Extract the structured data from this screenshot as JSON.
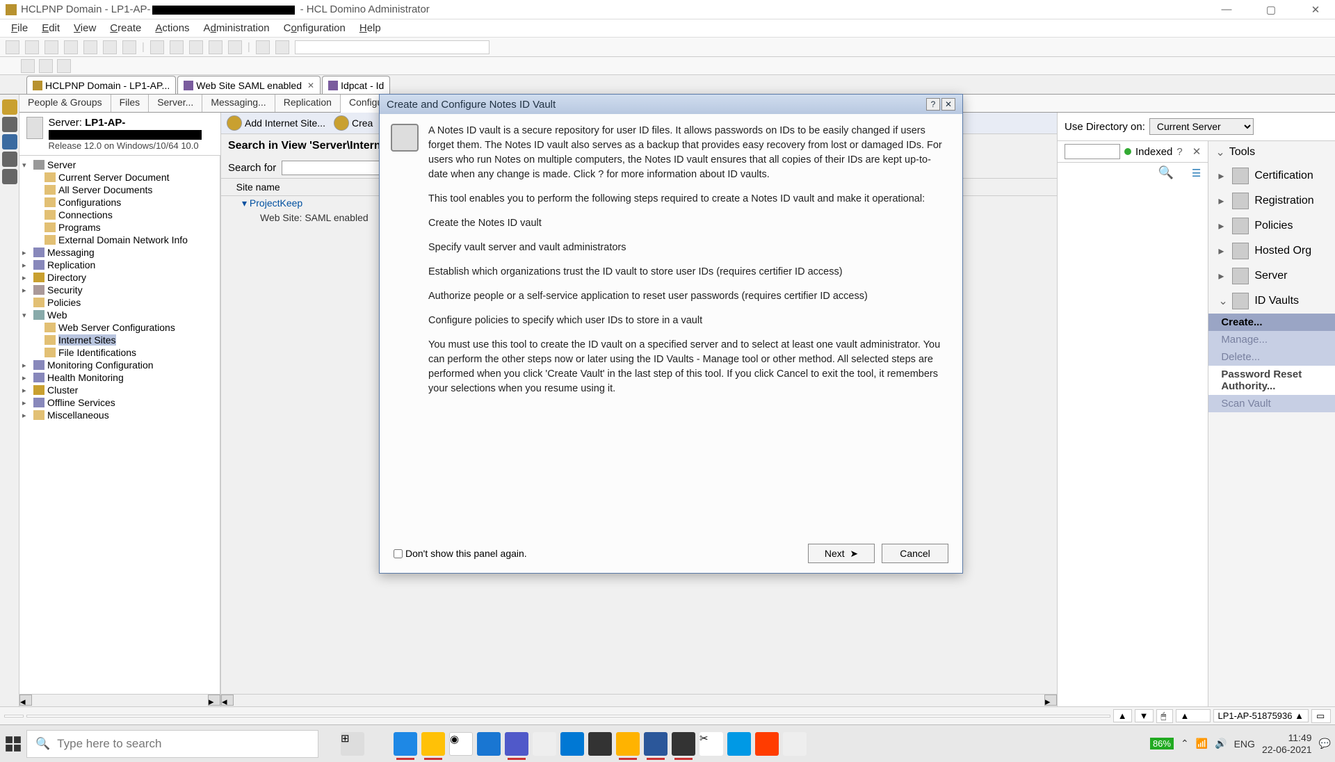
{
  "window": {
    "title_prefix": "HCLPNP Domain - LP1-AP-",
    "title_suffix": "- HCL Domino Administrator"
  },
  "menus": [
    "File",
    "Edit",
    "View",
    "Create",
    "Actions",
    "Administration",
    "Configuration",
    "Help"
  ],
  "tabs": [
    {
      "label": "HCLPNP Domain - LP1-AP..."
    },
    {
      "label": "Web Site SAML enabled"
    },
    {
      "label": "Idpcat - Id"
    }
  ],
  "subtabs": [
    "People & Groups",
    "Files",
    "Server...",
    "Messaging...",
    "Replication",
    "Configuration"
  ],
  "server": {
    "label": "Server:",
    "name_prefix": "LP1-AP-",
    "release": "Release 12.0 on Windows/10/64 10.0"
  },
  "tree": {
    "server": "Server",
    "csd": "Current Server Document",
    "asd": "All Server Documents",
    "conf": "Configurations",
    "conn": "Connections",
    "prog": "Programs",
    "edni": "External Domain Network Info",
    "msg": "Messaging",
    "repl": "Replication",
    "dir": "Directory",
    "sec": "Security",
    "pol": "Policies",
    "web": "Web",
    "wsc": "Web Server Configurations",
    "isites": "Internet Sites",
    "fid": "File Identifications",
    "monc": "Monitoring Configuration",
    "hm": "Health Monitoring",
    "cluster": "Cluster",
    "off": "Offline Services",
    "misc": "Miscellaneous"
  },
  "actions": {
    "add": "Add Internet Site...",
    "create": "Crea"
  },
  "search": {
    "header": "Search in View 'Server\\Intern",
    "label": "Search for",
    "col": "Site name",
    "row1": "ProjectKeep",
    "row2": "Web Site: SAML enabled"
  },
  "rightTop": {
    "useDir": "Use Directory on:",
    "curServer": "Current Server",
    "tools": "Tools",
    "indexed": "Indexed"
  },
  "tools": {
    "cert": "Certification",
    "reg": "Registration",
    "pol": "Policies",
    "host": "Hosted Org",
    "srv": "Server",
    "idv": "ID Vaults",
    "create": "Create...",
    "manage": "Manage...",
    "delete": "Delete...",
    "pra": "Password Reset Authority...",
    "scan": "Scan Vault"
  },
  "dialog": {
    "title": "Create and Configure Notes ID Vault",
    "p1": "A Notes ID vault is a secure repository for user ID files. It allows passwords on IDs to be easily changed if users forget them. The Notes ID vault also serves as a backup that provides easy recovery from lost or damaged IDs. For users who run Notes on multiple computers, the Notes ID vault ensures that all copies of their IDs are kept up-to-date when any change is made.  Click ? for more information about ID vaults.",
    "p2": "This tool enables you to perform the following steps required to create a Notes ID vault and make it operational:",
    "s1": "Create the Notes ID vault",
    "s2": "Specify vault server and vault administrators",
    "s3": "Establish which organizations trust the ID vault to store user IDs (requires certifier ID access)",
    "s4": "Authorize people or a self-service application to reset user passwords (requires certifier ID access)",
    "s5": "Configure policies to specify which user IDs to store in a vault",
    "p3": "You must use this tool to create the ID vault on a specified server and to select at least one vault administrator. You can perform the other steps now or later using the ID Vaults - Manage tool or other method. All selected steps are performed when you click 'Create Vault' in the last step of this tool. If you click Cancel to exit the tool, it remembers your selections when you resume using it.",
    "dontshow": "Don't show this panel again.",
    "next": "Next",
    "cancel": "Cancel"
  },
  "status": {
    "server": "LP1-AP-51875936"
  },
  "taskbar": {
    "search": "Type here to search",
    "battery": "86%",
    "lang": "ENG",
    "time": "11:49",
    "date": "22-06-2021"
  }
}
